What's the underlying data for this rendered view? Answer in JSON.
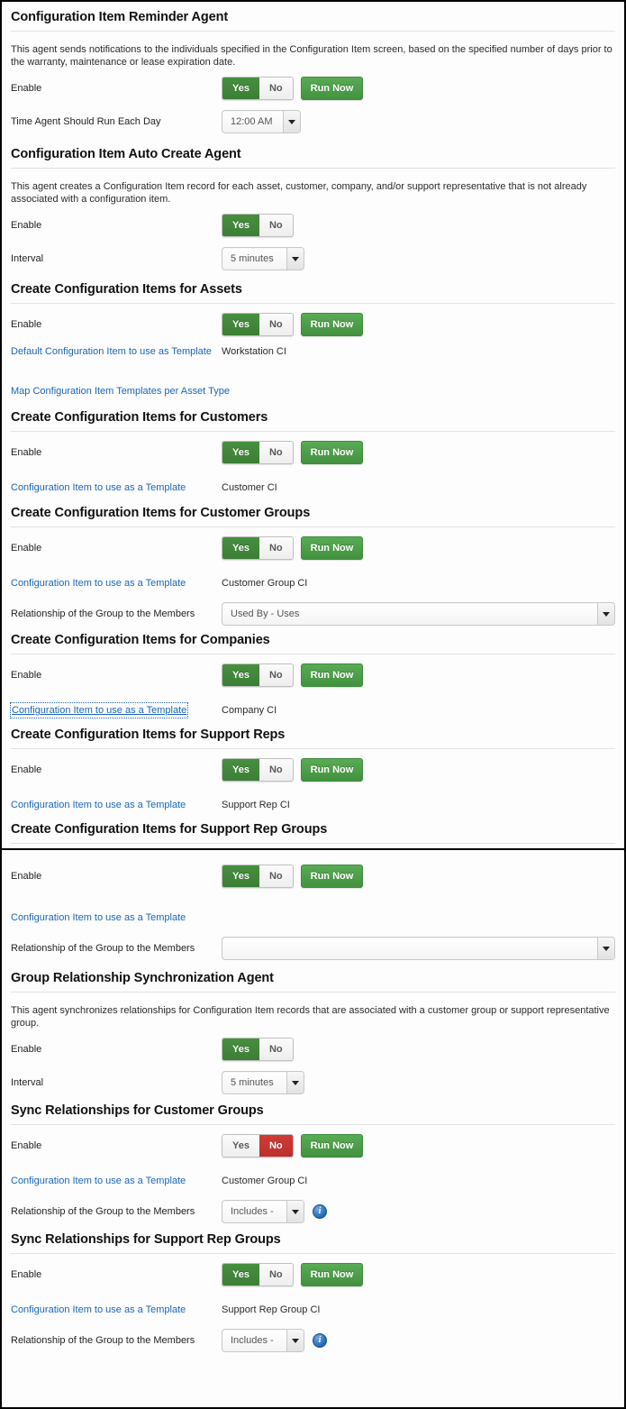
{
  "labels": {
    "enable": "Enable",
    "interval": "Interval",
    "time_agent": "Time Agent Should Run Each Day",
    "relationship": "Relationship of the Group to the Members",
    "ci_template": "Configuration Item to use as a Template",
    "default_ci_template": "Default Configuration Item to use as Template",
    "map_templates": "Map Configuration Item Templates per Asset Type",
    "yes": "Yes",
    "no": "No",
    "run_now": "Run Now",
    "info": "i"
  },
  "sections": [
    {
      "id": "ci-reminder-agent",
      "title": "Configuration Item Reminder Agent",
      "description": "This agent sends notifications to the individuals specified in the Configuration Item screen, based on the specified number of days prior to the warranty, maintenance or lease expiration date.",
      "enable": "Yes",
      "run_now": true,
      "time_value": "12:00 AM"
    },
    {
      "id": "ci-auto-create-agent",
      "title": "Configuration Item Auto Create Agent",
      "description": "This agent creates a Configuration Item record for each asset, customer, company, and/or support representative that is not already associated with a configuration item.",
      "enable": "Yes",
      "run_now": false,
      "interval_value": "5 minutes"
    },
    {
      "id": "create-ci-assets",
      "title": "Create Configuration Items for Assets",
      "enable": "Yes",
      "run_now": true,
      "template_value": "Workstation CI"
    },
    {
      "id": "create-ci-customers",
      "title": "Create Configuration Items for Customers",
      "enable": "Yes",
      "run_now": true,
      "template_value": "Customer CI"
    },
    {
      "id": "create-ci-customer-groups",
      "title": "Create Configuration Items for Customer Groups",
      "enable": "Yes",
      "run_now": true,
      "template_value": "Customer Group CI",
      "relationship_value": "Used By - Uses"
    },
    {
      "id": "create-ci-companies",
      "title": "Create Configuration Items for Companies",
      "enable": "Yes",
      "run_now": true,
      "template_value": "Company CI"
    },
    {
      "id": "create-ci-support-reps",
      "title": "Create Configuration Items for Support Reps",
      "enable": "Yes",
      "run_now": true,
      "template_value": "Support Rep CI"
    },
    {
      "id": "create-ci-support-rep-groups",
      "title": "Create Configuration Items for Support Rep Groups",
      "enable": "Yes",
      "run_now": true,
      "template_value": "",
      "relationship_value": ""
    },
    {
      "id": "group-relationship-sync-agent",
      "title": "Group Relationship Synchronization Agent",
      "description": "This agent synchronizes relationships for Configuration Item records that are associated with a customer group or support representative group.",
      "enable": "Yes",
      "run_now": false,
      "interval_value": "5 minutes"
    },
    {
      "id": "sync-rel-customer-groups",
      "title": "Sync Relationships for Customer Groups",
      "enable": "No",
      "run_now": true,
      "template_value": "Customer Group CI",
      "relationship_value": "Includes -"
    },
    {
      "id": "sync-rel-support-rep-groups",
      "title": "Sync Relationships for Support Rep Groups",
      "enable": "Yes",
      "run_now": true,
      "template_value": "Support Rep Group CI",
      "relationship_value": "Includes -"
    }
  ],
  "colors": {
    "yes_green": "#3c7e36",
    "no_red": "#bd2f2b",
    "run_now_green": "#43913f",
    "link_blue": "#1866b5",
    "panel_border": "#000000"
  }
}
